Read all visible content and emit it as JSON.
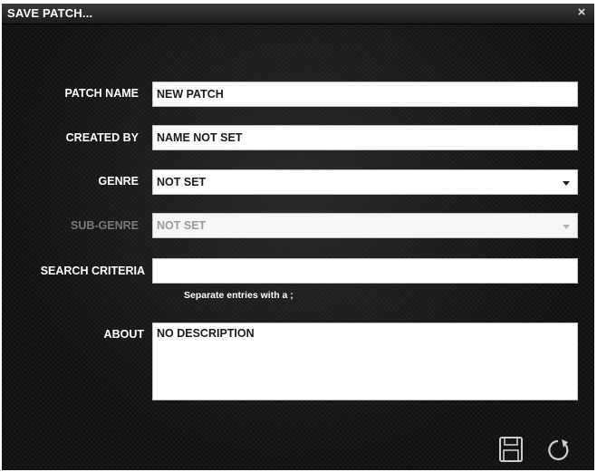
{
  "dialog": {
    "title": "SAVE PATCH...",
    "close_symbol": "×"
  },
  "form": {
    "patch_name": {
      "label": "PATCH NAME",
      "value": "NEW PATCH"
    },
    "created_by": {
      "label": "CREATED BY",
      "value": "NAME NOT SET"
    },
    "genre": {
      "label": "GENRE",
      "value": "NOT SET",
      "enabled": true
    },
    "sub_genre": {
      "label": "SUB-GENRE",
      "value": "NOT SET",
      "enabled": false
    },
    "search_criteria": {
      "label": "SEARCH CRITERIA",
      "value": "",
      "hint": "Separate entries with a ;"
    },
    "about": {
      "label": "ABOUT",
      "value": "NO DESCRIPTION"
    }
  },
  "actions": {
    "save_icon": "floppy-disk-icon",
    "reset_icon": "refresh-icon"
  },
  "colors": {
    "background": "#141414",
    "label_text": "#ffffff",
    "disabled_label": "#7a7a7a",
    "field_bg": "#ffffff",
    "field_text": "#1a1a1a"
  }
}
